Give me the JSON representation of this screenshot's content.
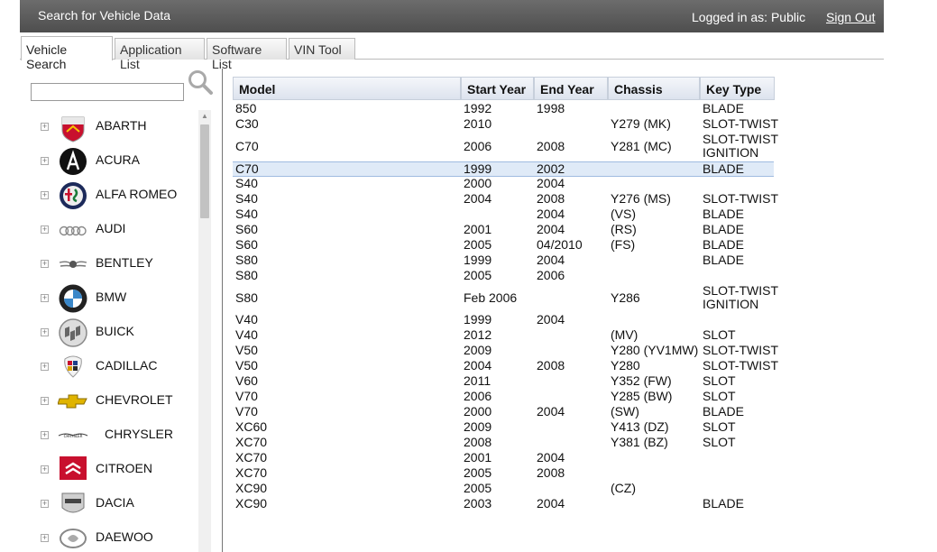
{
  "header": {
    "title": "Search for Vehicle Data",
    "logged_in": "Logged in as: Public",
    "sign_out": "Sign Out"
  },
  "tabs": [
    {
      "label": "Vehicle Search",
      "active": true
    },
    {
      "label": "Application List",
      "active": false
    },
    {
      "label": "Software List",
      "active": false
    },
    {
      "label": "VIN Tool",
      "active": false
    }
  ],
  "search": {
    "value": "",
    "placeholder": ""
  },
  "makes": [
    {
      "name": "ABARTH",
      "icon": "abarth-logo-icon"
    },
    {
      "name": "ACURA",
      "icon": "acura-logo-icon"
    },
    {
      "name": "ALFA ROMEO",
      "icon": "alfa-romeo-logo-icon"
    },
    {
      "name": "AUDI",
      "icon": "audi-logo-icon"
    },
    {
      "name": "BENTLEY",
      "icon": "bentley-logo-icon"
    },
    {
      "name": "BMW",
      "icon": "bmw-logo-icon"
    },
    {
      "name": "BUICK",
      "icon": "buick-logo-icon"
    },
    {
      "name": "CADILLAC",
      "icon": "cadillac-logo-icon"
    },
    {
      "name": "CHEVROLET",
      "icon": "chevrolet-logo-icon"
    },
    {
      "name": "CHRYSLER",
      "icon": "chrysler-logo-icon"
    },
    {
      "name": "CITROEN",
      "icon": "citroen-logo-icon"
    },
    {
      "name": "DACIA",
      "icon": "dacia-logo-icon"
    },
    {
      "name": "DAEWOO",
      "icon": "daewoo-logo-icon"
    }
  ],
  "table": {
    "columns": [
      "Model",
      "Start Year",
      "End Year",
      "Chassis",
      "Key Type"
    ],
    "rows": [
      {
        "model": "850",
        "start": "1992",
        "end": "1998",
        "chassis": "",
        "key": [
          "BLADE"
        ]
      },
      {
        "model": "C30",
        "start": "2010",
        "end": "",
        "chassis": "Y279 (MK)",
        "key": [
          "SLOT-TWIST"
        ]
      },
      {
        "model": "C70",
        "start": "2006",
        "end": "2008",
        "chassis": "Y281 (MC)",
        "key": [
          "SLOT-TWIST",
          "IGNITION"
        ]
      },
      {
        "model": "C70",
        "start": "1999",
        "end": "2002",
        "chassis": "",
        "key": [
          "BLADE"
        ],
        "selected": true
      },
      {
        "model": "S40",
        "start": "2000",
        "end": "2004",
        "chassis": "",
        "key": [
          ""
        ]
      },
      {
        "model": "S40",
        "start": "2004",
        "end": "2008",
        "chassis": "Y276 (MS)",
        "key": [
          "SLOT-TWIST"
        ]
      },
      {
        "model": "S40",
        "start": "",
        "end": "2004",
        "chassis": "(VS)",
        "key": [
          "BLADE"
        ]
      },
      {
        "model": "S60",
        "start": "2001",
        "end": "2004",
        "chassis": "(RS)",
        "key": [
          "BLADE"
        ]
      },
      {
        "model": "S60",
        "start": "2005",
        "end": "04/2010",
        "chassis": "(FS)",
        "key": [
          "BLADE"
        ]
      },
      {
        "model": "S80",
        "start": "1999",
        "end": "2004",
        "chassis": "",
        "key": [
          "BLADE"
        ]
      },
      {
        "model": "S80",
        "start": "2005",
        "end": "2006",
        "chassis": "",
        "key": [
          ""
        ]
      },
      {
        "model": "S80",
        "start": "Feb 2006",
        "end": "",
        "chassis": "Y286",
        "key": [
          "SLOT-TWIST",
          "IGNITION"
        ]
      },
      {
        "model": "V40",
        "start": "1999",
        "end": "2004",
        "chassis": "",
        "key": [
          ""
        ]
      },
      {
        "model": "V40",
        "start": "2012",
        "end": "",
        "chassis": "(MV)",
        "key": [
          "SLOT"
        ]
      },
      {
        "model": "V50",
        "start": "2009",
        "end": "",
        "chassis": "Y280 (YV1MW)",
        "key": [
          "SLOT-TWIST"
        ]
      },
      {
        "model": "V50",
        "start": "2004",
        "end": "2008",
        "chassis": "Y280",
        "key": [
          "SLOT-TWIST"
        ]
      },
      {
        "model": "V60",
        "start": "2011",
        "end": "",
        "chassis": "Y352 (FW)",
        "key": [
          "SLOT"
        ]
      },
      {
        "model": "V70",
        "start": "2006",
        "end": "",
        "chassis": "Y285 (BW)",
        "key": [
          "SLOT"
        ]
      },
      {
        "model": "V70",
        "start": "2000",
        "end": "2004",
        "chassis": "(SW)",
        "key": [
          "BLADE"
        ]
      },
      {
        "model": "XC60",
        "start": "2009",
        "end": "",
        "chassis": "Y413 (DZ)",
        "key": [
          "SLOT"
        ]
      },
      {
        "model": "XC70",
        "start": "2008",
        "end": "",
        "chassis": "Y381 (BZ)",
        "key": [
          "SLOT"
        ]
      },
      {
        "model": "XC70",
        "start": "2001",
        "end": "2004",
        "chassis": "",
        "key": [
          ""
        ]
      },
      {
        "model": "XC70",
        "start": "2005",
        "end": "2008",
        "chassis": "",
        "key": [
          ""
        ]
      },
      {
        "model": "XC90",
        "start": "2005",
        "end": "",
        "chassis": "(CZ)",
        "key": [
          ""
        ]
      },
      {
        "model": "XC90",
        "start": "2003",
        "end": "2004",
        "chassis": "",
        "key": [
          "BLADE"
        ]
      }
    ]
  }
}
